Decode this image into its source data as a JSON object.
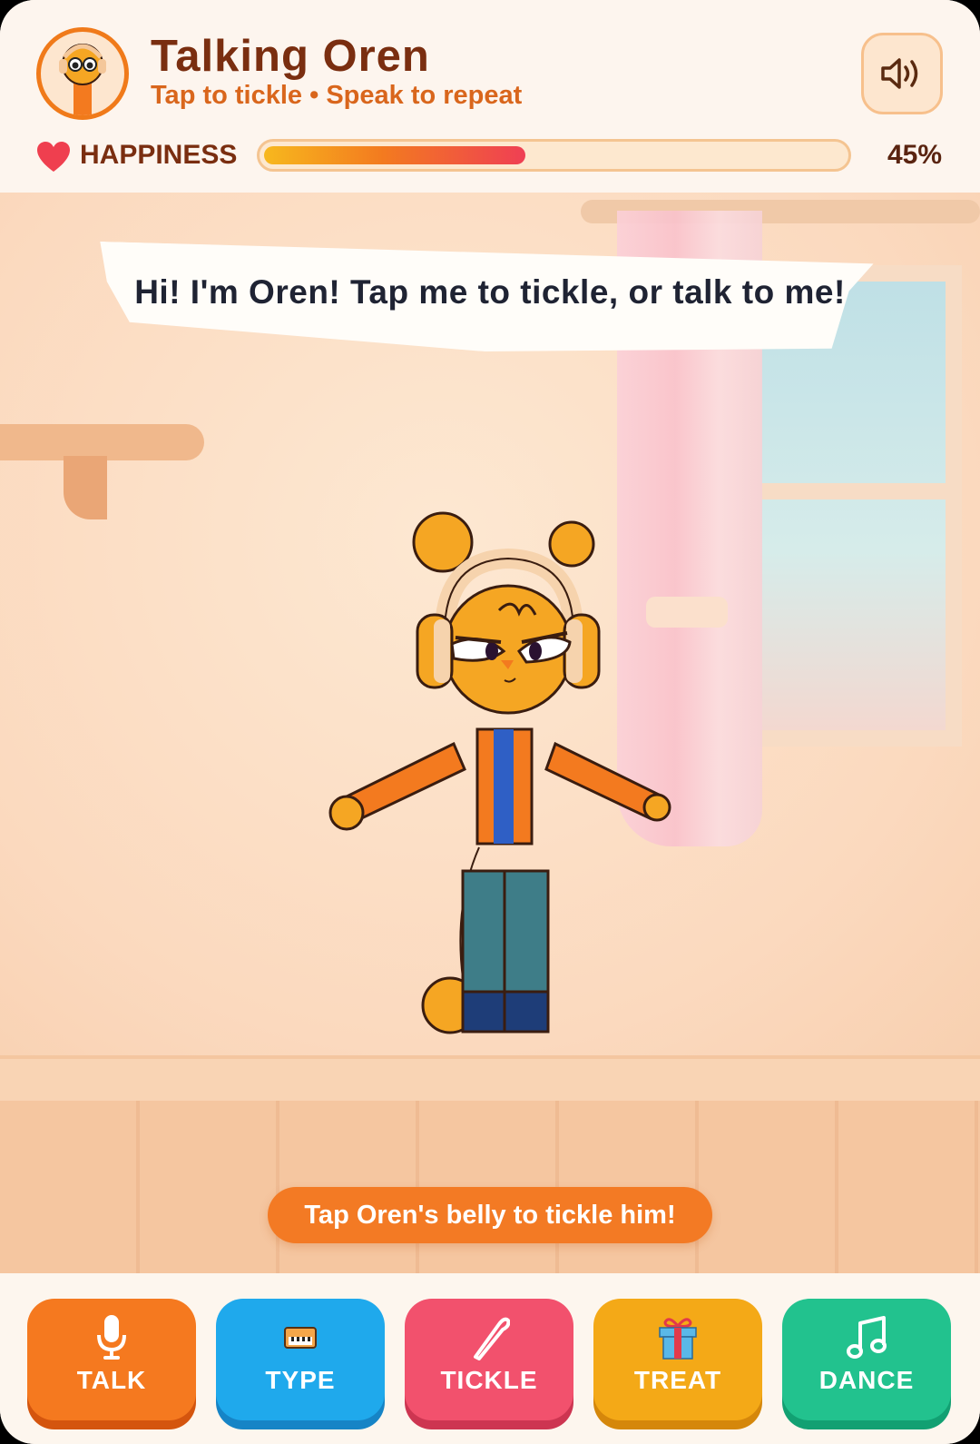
{
  "header": {
    "title": "Talking Oren",
    "subtitle": "Tap to tickle • Speak to repeat",
    "sound_icon": "speaker-volume-icon"
  },
  "happiness": {
    "label": "HAPPINESS",
    "value_percent": 45,
    "display": "45%",
    "icon": "heart-icon"
  },
  "scene": {
    "speech": "Hi! I'm Oren! Tap me to tickle, or talk to me!",
    "hint": "Tap Oren's belly to tickle him!"
  },
  "actions": [
    {
      "label": "TALK",
      "icon": "microphone-icon",
      "color": "#f5791f"
    },
    {
      "label": "TYPE",
      "icon": "keyboard-icon",
      "color": "#1fa9ec"
    },
    {
      "label": "TICKLE",
      "icon": "feather-icon",
      "color": "#f2516d"
    },
    {
      "label": "TREAT",
      "icon": "gift-icon",
      "color": "#f4a917"
    },
    {
      "label": "DANCE",
      "icon": "music-note-icon",
      "color": "#22c28e"
    }
  ],
  "colors": {
    "brand": "#f07a1a",
    "title": "#7a2e10",
    "background": "#fdf6ee"
  }
}
